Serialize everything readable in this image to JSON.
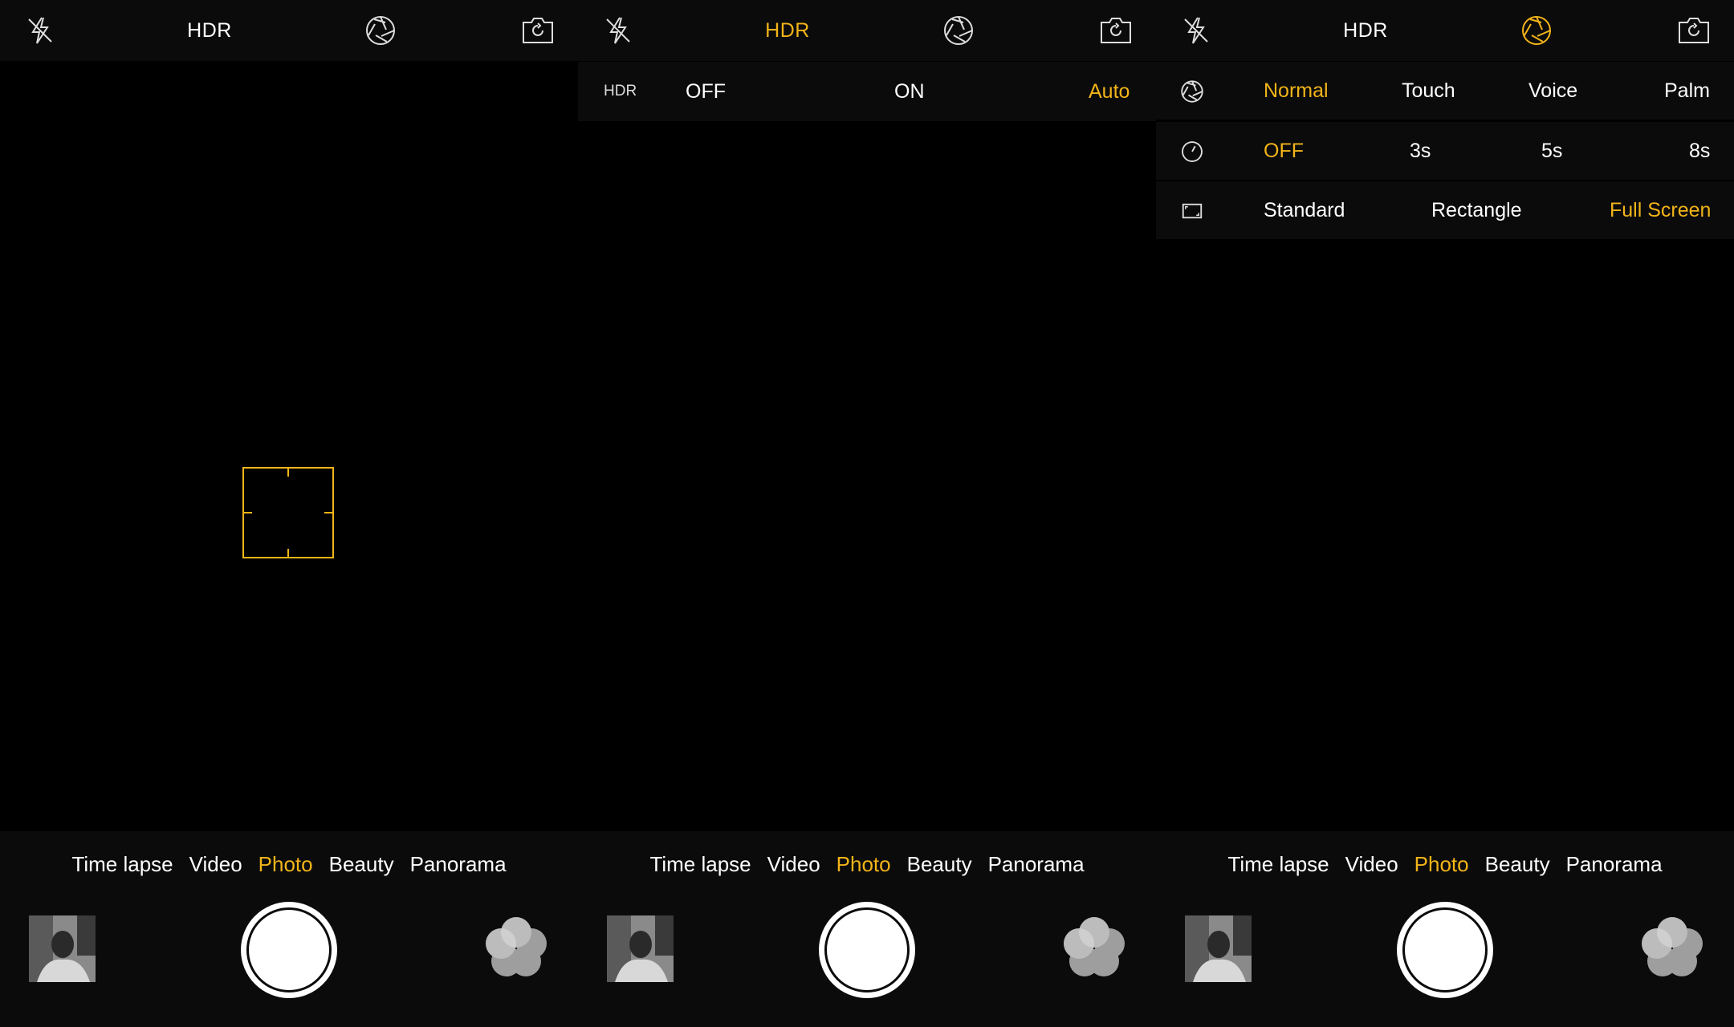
{
  "colors": {
    "accent": "#f2b419",
    "background": "#000000",
    "bar": "#0b0b0b"
  },
  "icons": {
    "flash": "flash-off-icon",
    "aperture": "aperture-icon",
    "switch": "camera-switch-icon",
    "timer": "timer-icon",
    "ratio": "aspect-ratio-icon",
    "filters": "filters-icon"
  },
  "panels": [
    {
      "topbar": {
        "hdr_label": "HDR"
      },
      "modes": [
        "Time lapse",
        "Video",
        "Photo",
        "Beauty",
        "Panorama"
      ],
      "active_mode": "Photo"
    },
    {
      "topbar": {
        "hdr_label": "HDR"
      },
      "hdr_menu": {
        "label": "HDR",
        "options": [
          "OFF",
          "ON",
          "Auto"
        ],
        "selected": "Auto"
      },
      "modes": [
        "Time lapse",
        "Video",
        "Photo",
        "Beauty",
        "Panorama"
      ],
      "active_mode": "Photo"
    },
    {
      "topbar": {
        "hdr_label": "HDR"
      },
      "settings": {
        "shutter_trigger": {
          "options": [
            "Normal",
            "Touch",
            "Voice",
            "Palm"
          ],
          "selected": "Normal"
        },
        "timer": {
          "options": [
            "OFF",
            "3s",
            "5s",
            "8s"
          ],
          "selected": "OFF"
        },
        "ratio": {
          "options": [
            "Standard",
            "Rectangle",
            "Full Screen"
          ],
          "selected": "Full Screen"
        }
      },
      "modes": [
        "Time lapse",
        "Video",
        "Photo",
        "Beauty",
        "Panorama"
      ],
      "active_mode": "Photo"
    }
  ]
}
